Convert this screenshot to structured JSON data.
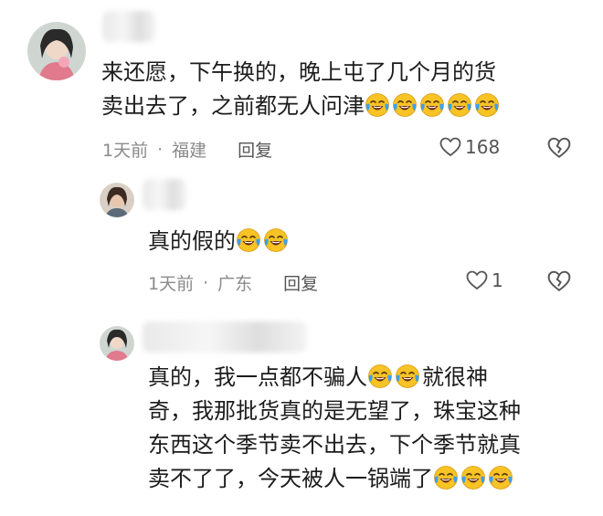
{
  "comments": [
    {
      "text_lines": [
        "来还愿，下午换的，晚上屯了几个月的货",
        "卖出去了，之前都无人问津"
      ],
      "emoji_count": 5,
      "time": "1天前",
      "location": "福建",
      "reply_label": "回复",
      "likes": "168"
    },
    {
      "text_lines": [
        "真的假的"
      ],
      "emoji_count": 2,
      "time": "1天前",
      "location": "广东",
      "reply_label": "回复",
      "likes": "1"
    },
    {
      "text_lines": [
        "真的，我一点都不骗人",
        "就很神",
        "奇，我那批货真的是无望了，珠宝这种",
        "东西这个季节卖不出去，下个季节就真",
        "卖不了了，今天被人一锅端了"
      ]
    }
  ],
  "separator": "·",
  "icons": {
    "emoji": "laughing-crying-emoji",
    "like": "heart-outline-icon",
    "dislike": "broken-heart-icon"
  },
  "colors": {
    "emoji_face": "#f7c325",
    "emoji_tear": "#3aa0f0",
    "meta_text": "#8a8a8a"
  }
}
